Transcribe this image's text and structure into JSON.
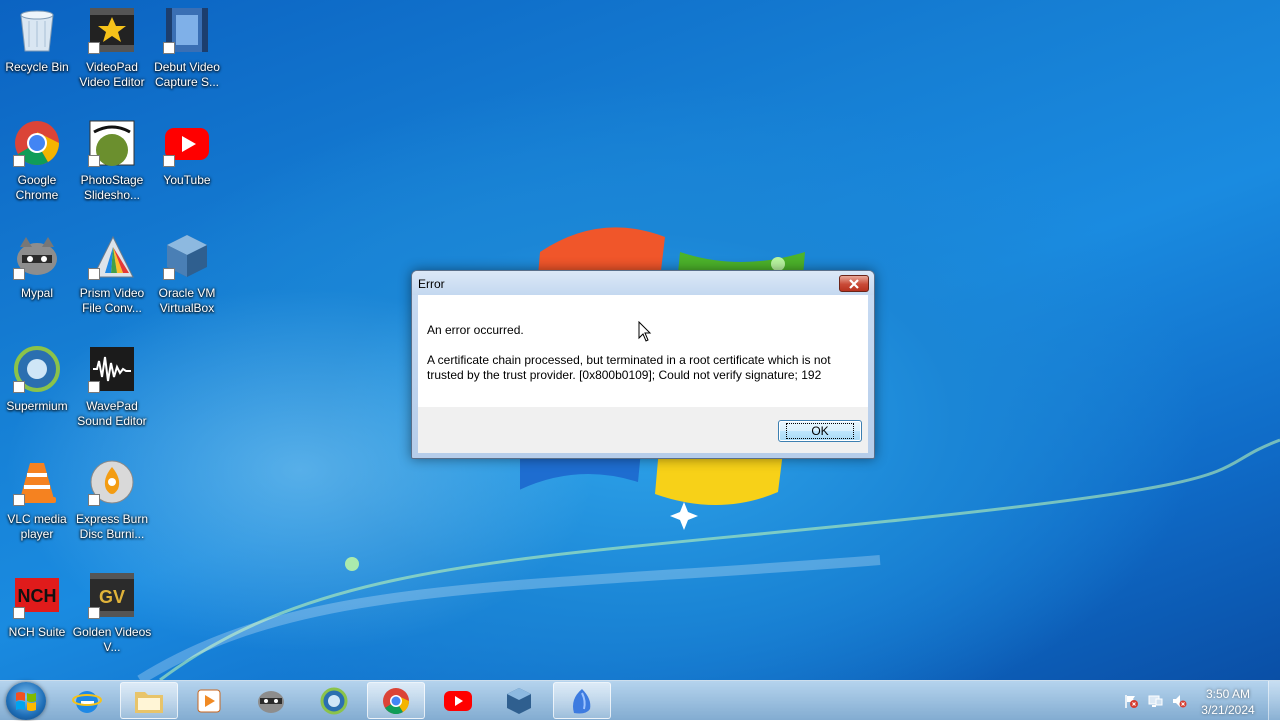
{
  "desktop": {
    "icons": [
      {
        "label": "Recycle Bin",
        "icon": "recycle-bin-icon"
      },
      {
        "label": "VideoPad Video Editor",
        "icon": "videopad-icon"
      },
      {
        "label": "Debut Video Capture S...",
        "icon": "debut-video-icon"
      },
      {
        "label": "Google Chrome",
        "icon": "chrome-icon"
      },
      {
        "label": "PhotoStage Slidesho...",
        "icon": "photostage-icon"
      },
      {
        "label": "YouTube",
        "icon": "youtube-icon"
      },
      {
        "label": "Mypal",
        "icon": "mypal-icon"
      },
      {
        "label": "Prism Video File Conv...",
        "icon": "prism-icon"
      },
      {
        "label": "Oracle VM VirtualBox",
        "icon": "virtualbox-icon"
      },
      {
        "label": "Supermium",
        "icon": "supermium-icon"
      },
      {
        "label": "WavePad Sound Editor",
        "icon": "wavepad-icon"
      },
      {
        "label": "VLC media player",
        "icon": "vlc-icon"
      },
      {
        "label": "Express Burn Disc Burni...",
        "icon": "express-burn-icon"
      },
      {
        "label": "NCH Suite",
        "icon": "nch-suite-icon"
      },
      {
        "label": "Golden Videos V...",
        "icon": "golden-videos-icon"
      }
    ]
  },
  "dialog": {
    "title": "Error",
    "message_heading": "An error occurred.",
    "message_body": "A certificate chain processed, but terminated in a root certificate which is not trusted by the trust provider. [0x800b0109]; Could not verify signature; 192",
    "ok_label": "OK"
  },
  "taskbar": {
    "pinned": [
      {
        "app": "Internet Explorer",
        "icon": "internet-explorer-icon",
        "active": false
      },
      {
        "app": "Windows Explorer",
        "icon": "folder-icon",
        "active": true
      },
      {
        "app": "Media Player",
        "icon": "media-player-icon",
        "active": false
      },
      {
        "app": "Mypal",
        "icon": "mypal-icon",
        "active": false
      },
      {
        "app": "Supermium",
        "icon": "supermium-icon",
        "active": false
      },
      {
        "app": "Google Chrome",
        "icon": "chrome-icon",
        "active": true
      },
      {
        "app": "YouTube",
        "icon": "youtube-icon",
        "active": false
      },
      {
        "app": "VirtualBox",
        "icon": "virtualbox-icon",
        "active": false
      },
      {
        "app": "Installer",
        "icon": "installer-icon",
        "active": true
      }
    ],
    "tray": [
      "action-center-flag-icon",
      "network-icon",
      "volume-muted-icon"
    ],
    "clock": {
      "time": "3:50 AM",
      "date": "3/21/2024"
    }
  },
  "colors": {
    "accent": "#1b86d6",
    "dialog_border": "#5a6f8a",
    "close_red": "#c94a37"
  }
}
